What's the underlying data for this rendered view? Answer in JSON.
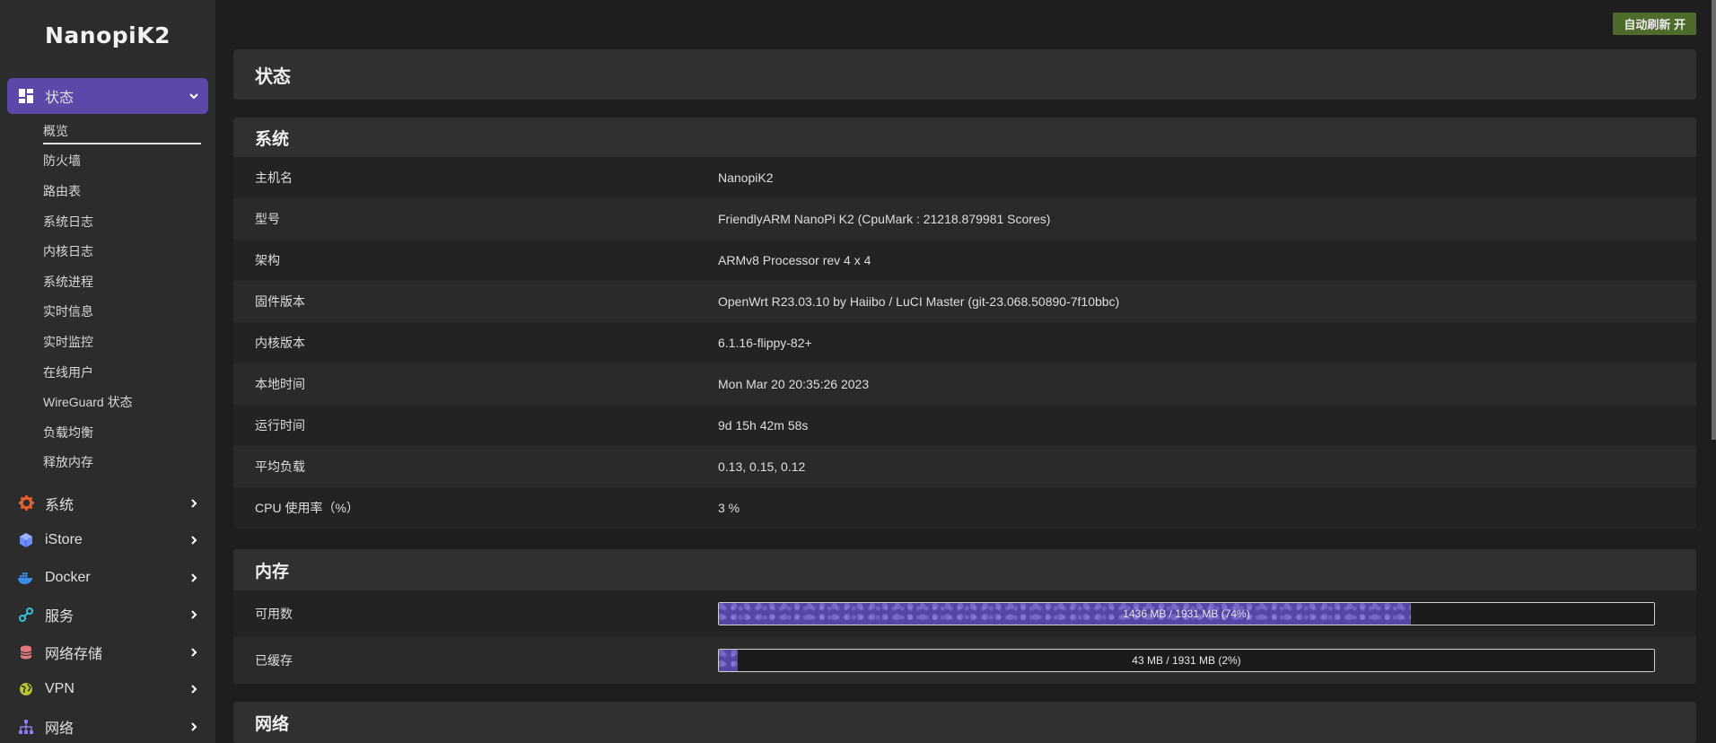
{
  "brand": "NanopiK2",
  "sidebar": {
    "active": {
      "label": "状态",
      "icon": "dashboard-icon"
    },
    "submenu": [
      "概览",
      "防火墙",
      "路由表",
      "系统日志",
      "内核日志",
      "系统进程",
      "实时信息",
      "实时监控",
      "在线用户",
      "WireGuard 状态",
      "负载均衡",
      "释放内存"
    ],
    "items": [
      {
        "label": "系统",
        "icon": "gear-icon",
        "color": "#e8612c"
      },
      {
        "label": "iStore",
        "icon": "cube-icon",
        "color": "#6b8cff"
      },
      {
        "label": "Docker",
        "icon": "docker-whale-icon",
        "color": "#3a8ee6"
      },
      {
        "label": "服务",
        "icon": "services-link-icon",
        "color": "#36c2e0"
      },
      {
        "label": "网络存储",
        "icon": "database-icon",
        "color": "#e07a7a"
      },
      {
        "label": "VPN",
        "icon": "globe-icon",
        "color": "#b9c531"
      },
      {
        "label": "网络",
        "icon": "network-tree-icon",
        "color": "#8a7cf0"
      }
    ]
  },
  "header": {
    "refresh_label": "自动刷新 开"
  },
  "status_card": {
    "title": "状态"
  },
  "system_card": {
    "title": "系统",
    "rows": [
      {
        "key": "主机名",
        "value": "NanopiK2"
      },
      {
        "key": "型号",
        "value": "FriendlyARM NanoPi K2 (CpuMark : 21218.879981 Scores)"
      },
      {
        "key": "架构",
        "value": "ARMv8 Processor rev 4 x 4"
      },
      {
        "key": "固件版本",
        "value": "OpenWrt R23.03.10 by Haiibo / LuCI Master (git-23.068.50890-7f10bbc)"
      },
      {
        "key": "内核版本",
        "value": "6.1.16-flippy-82+"
      },
      {
        "key": "本地时间",
        "value": "Mon Mar 20 20:35:26 2023"
      },
      {
        "key": "运行时间",
        "value": "9d 15h 42m 58s"
      },
      {
        "key": "平均负载",
        "value": "0.13, 0.15, 0.12"
      },
      {
        "key": "CPU 使用率（%）",
        "value": "3 %"
      }
    ]
  },
  "memory_card": {
    "title": "内存",
    "rows": [
      {
        "key": "可用数",
        "text": "1436 MB / 1931 MB (74%)",
        "percent": 74
      },
      {
        "key": "已缓存",
        "text": "43 MB / 1931 MB (2%)",
        "percent": 2
      }
    ]
  },
  "network_card": {
    "title": "网络"
  }
}
